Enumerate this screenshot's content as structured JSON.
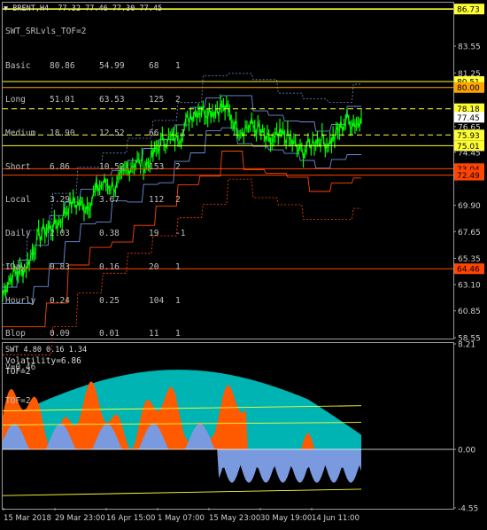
{
  "header": {
    "symbol_line": "▼ BRENT,H4  77.32 77.46 77.30 77.45"
  },
  "price_panel": {
    "indicator_name": "SWT_SRLvls_TOF=2",
    "table": [
      [
        "Basic",
        "80.86",
        "54.99",
        "68",
        "1"
      ],
      [
        "Long",
        "51.01",
        "63.53",
        "125",
        "2"
      ],
      [
        "Medium",
        "18.90",
        "12.52",
        "66",
        "-1"
      ],
      [
        "Short",
        "6.86",
        "10.52",
        "153",
        "2"
      ],
      [
        "Local",
        "3.29",
        "3.67",
        "112",
        "2"
      ],
      [
        "Daily",
        "2.03",
        "0.38",
        "19",
        "-1"
      ],
      [
        "IDay",
        "0.83",
        "0.16",
        "20",
        "1"
      ],
      [
        "Hourly",
        "0.24",
        "0.25",
        "104",
        "1"
      ],
      [
        "Blop",
        "0.09",
        "0.01",
        "11",
        "1"
      ]
    ],
    "v_line": "V=0.46",
    "tof_line": "TOF=2",
    "y_ticks": [
      "83.55",
      "81.25",
      "76.65",
      "74.45",
      "69.90",
      "67.65",
      "65.35",
      "63.10",
      "60.85",
      "58.55"
    ],
    "level_labels": [
      {
        "text": "86.73",
        "value": 86.73,
        "bg": "#ffff33",
        "fg": "#000000"
      },
      {
        "text": "80.51",
        "value": 80.51,
        "bg": "#ffff33",
        "fg": "#000000"
      },
      {
        "text": "80.00",
        "value": 80.0,
        "bg": "#ffa500",
        "fg": "#000000"
      },
      {
        "text": "78.18",
        "value": 78.18,
        "bg": "#ffff33",
        "fg": "#000000"
      },
      {
        "text": "77.45",
        "value": 77.45,
        "bg": "#ffffff",
        "fg": "#000000"
      },
      {
        "text": "75.93",
        "value": 75.93,
        "bg": "#ffff33",
        "fg": "#000000"
      },
      {
        "text": "75.01",
        "value": 75.01,
        "bg": "#ffff33",
        "fg": "#000000"
      },
      {
        "text": "73.04",
        "value": 73.04,
        "bg": "#ff4500",
        "fg": "#000000"
      },
      {
        "text": "72.49",
        "value": 72.49,
        "bg": "#ff4500",
        "fg": "#000000"
      },
      {
        "text": "64.46",
        "value": 64.46,
        "bg": "#ff4500",
        "fg": "#000000"
      }
    ]
  },
  "osc_panel": {
    "title_line": "SWT 4.80 0.16 1.34",
    "volatility_line": "Volatility=6.86",
    "tof_line": "TOF=2",
    "y_ticks": [
      "8.21",
      "0.00",
      "-4.55"
    ]
  },
  "x_axis": {
    "labels": [
      "15 Mar 2018",
      "29 Mar 23:00",
      "16 Apr 15:00",
      "1 May 07:00",
      "15 May 23:00",
      "30 May 19:00",
      "14 Jun 11:00"
    ]
  },
  "colors": {
    "background": "#000000",
    "price_candles": "#00ff00",
    "support_lines": "#ff4500",
    "resistance_lines": "#ffff33",
    "channel_blue": "#6a8fd8",
    "osc_cyan": "#00c8c8",
    "osc_orange": "#ff5a00",
    "osc_blue": "#7a9ae0"
  },
  "chart_data": {
    "type": "line",
    "x": [
      "15 Mar 2018",
      "29 Mar 23:00",
      "16 Apr 15:00",
      "1 May 07:00",
      "15 May 23:00",
      "30 May 19:00",
      "14 Jun 11:00"
    ],
    "series": [
      {
        "name": "BRENT,H4",
        "values": [
          62.3,
          68.6,
          71.4,
          74.5,
          78.6,
          76.0,
          74.8,
          77.45
        ]
      }
    ],
    "horizontal_levels": [
      86.73,
      80.51,
      80.0,
      78.18,
      75.93,
      75.01,
      73.04,
      72.49,
      64.46
    ],
    "ylim": [
      58.55,
      87.2
    ],
    "osc_ylim": [
      -4.55,
      8.21
    ],
    "grid": false,
    "legend": "none"
  }
}
